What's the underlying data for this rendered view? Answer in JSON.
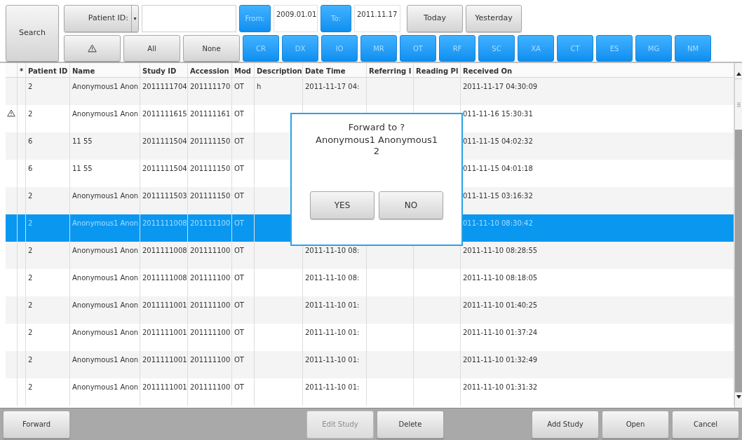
{
  "search_button": "Search",
  "patient_filter": {
    "label": "Patient ID:",
    "dropdown": "▾"
  },
  "date_range": {
    "from_label": "From:",
    "from": "2009.01.01",
    "to_label": "To:",
    "to": "2011.11.17"
  },
  "quick_dates": [
    "Today",
    "Yesterday"
  ],
  "flag_filters": [
    {
      "kind": "warning"
    },
    {
      "kind": "text",
      "label": "All"
    },
    {
      "kind": "text",
      "label": "None"
    }
  ],
  "modalities": [
    {
      "label": "CR",
      "selected": true
    },
    {
      "label": "DX",
      "selected": true
    },
    {
      "label": "IO",
      "selected": true
    },
    {
      "label": "MR",
      "selected": true
    },
    {
      "label": "OT",
      "selected": true
    },
    {
      "label": "RF",
      "selected": true
    },
    {
      "label": "SC",
      "selected": true
    },
    {
      "label": "XA",
      "selected": true
    },
    {
      "label": "CT",
      "selected": true
    },
    {
      "label": "ES",
      "selected": true
    },
    {
      "label": "MG",
      "selected": true
    },
    {
      "label": "NM",
      "selected": true
    }
  ],
  "table": {
    "columns": [
      "*",
      "Patient ID",
      "Name",
      "Study ID",
      "Accession",
      "Mod",
      "Description",
      "Date Time",
      "Referring I",
      "Reading Pl",
      "Received On"
    ],
    "rows": [
      {
        "flagged": false,
        "selected": false,
        "patient_id": "2",
        "name": "Anonymous1 Anon",
        "study_id": "2011111704",
        "accession": "201111170",
        "mod": "OT",
        "description": "h",
        "date_time": "2011-11-17 04:",
        "received_on": "2011-11-17 04:30:09"
      },
      {
        "flagged": true,
        "selected": false,
        "patient_id": "2",
        "name": "Anonymous1 Anon",
        "study_id": "2011111615",
        "accession": "201111161",
        "mod": "OT",
        "received_on": "011-11-16 15:30:31"
      },
      {
        "flagged": false,
        "selected": false,
        "patient_id": "6",
        "name": "11 55",
        "study_id": "2011111504",
        "accession": "201111150",
        "mod": "OT",
        "received_on": "011-11-15 04:02:32"
      },
      {
        "flagged": false,
        "selected": false,
        "patient_id": "6",
        "name": "11 55",
        "study_id": "2011111504",
        "accession": "201111150",
        "mod": "OT",
        "received_on": "011-11-15 04:01:18"
      },
      {
        "flagged": false,
        "selected": false,
        "patient_id": "2",
        "name": "Anonymous1 Anon",
        "study_id": "2011111503",
        "accession": "201111150",
        "mod": "OT",
        "received_on": "011-11-15 03:16:32"
      },
      {
        "flagged": false,
        "selected": true,
        "patient_id": "2",
        "name": "Anonymous1 Anon",
        "study_id": "2011111008",
        "accession": "201111100",
        "mod": "OT",
        "received_on": "011-11-10 08:30:42"
      },
      {
        "flagged": false,
        "selected": false,
        "patient_id": "2",
        "name": "Anonymous1 Anon",
        "study_id": "2011111008",
        "accession": "201111100",
        "mod": "OT",
        "date_time": "2011-11-10 08:",
        "received_on": "2011-11-10 08:28:55"
      },
      {
        "flagged": false,
        "selected": false,
        "patient_id": "2",
        "name": "Anonymous1 Anon",
        "study_id": "2011111008",
        "accession": "201111100",
        "mod": "OT",
        "date_time": "2011-11-10 08:",
        "received_on": "2011-11-10 08:18:05"
      },
      {
        "flagged": false,
        "selected": false,
        "patient_id": "2",
        "name": "Anonymous1 Anon",
        "study_id": "2011111001",
        "accession": "201111100",
        "mod": "OT",
        "date_time": "2011-11-10 01:",
        "received_on": "2011-11-10 01:40:25"
      },
      {
        "flagged": false,
        "selected": false,
        "patient_id": "2",
        "name": "Anonymous1 Anon",
        "study_id": "2011111001",
        "accession": "201111100",
        "mod": "OT",
        "date_time": "2011-11-10 01:",
        "received_on": "2011-11-10 01:37:24"
      },
      {
        "flagged": false,
        "selected": false,
        "patient_id": "2",
        "name": "Anonymous1 Anon",
        "study_id": "2011111001",
        "accession": "201111100",
        "mod": "OT",
        "date_time": "2011-11-10 01:",
        "received_on": "2011-11-10 01:32:49"
      },
      {
        "flagged": false,
        "selected": false,
        "patient_id": "2",
        "name": "Anonymous1 Anon",
        "study_id": "2011111001",
        "accession": "201111100",
        "mod": "OT",
        "date_time": "2011-11-10 01:",
        "received_on": "2011-11-10 01:31:32"
      }
    ]
  },
  "dialog": {
    "title": "Forward to  ?",
    "message_lines": [
      "Anonymous1 Anonymous1",
      "2"
    ],
    "buttons": [
      "YES",
      "NO"
    ]
  },
  "actions": [
    {
      "label": "Forward",
      "disabled": false
    },
    {
      "label": "Edit Study",
      "disabled": true
    },
    {
      "label": "Delete",
      "disabled": false
    },
    {
      "label": "Add Study",
      "disabled": false
    },
    {
      "label": "Open",
      "disabled": false
    },
    {
      "label": "Cancel",
      "disabled": false
    }
  ]
}
